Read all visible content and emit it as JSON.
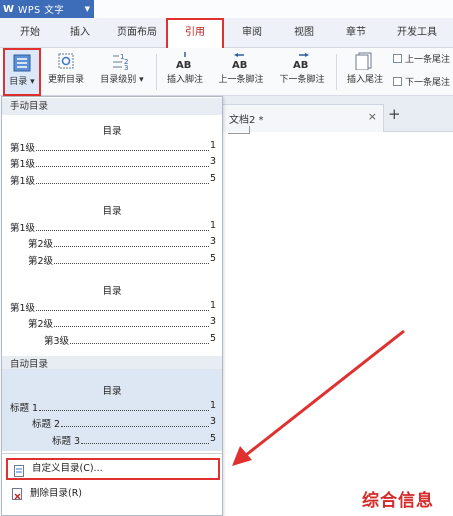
{
  "app": {
    "name": "WPS 文字"
  },
  "tabs": [
    {
      "label": "开始"
    },
    {
      "label": "插入"
    },
    {
      "label": "页面布局"
    },
    {
      "label": "引用"
    },
    {
      "label": "审阅"
    },
    {
      "label": "视图"
    },
    {
      "label": "章节"
    },
    {
      "label": "开发工具"
    }
  ],
  "active_tab": "引用",
  "ribbon": {
    "toc": "目录",
    "update_toc": "更新目录",
    "toc_level": "目录级别",
    "insert_footnote": "插入脚注",
    "prev_footnote": "上一条脚注",
    "next_footnote": "下一条脚注",
    "insert_endnote": "插入尾注",
    "prev_endnote": "上一条尾注",
    "next_endnote": "下一条尾注",
    "ab_glyph": "AB"
  },
  "document_tab": {
    "label": "文档2 *",
    "close": "×",
    "new": "+"
  },
  "dropdown": {
    "manual_header": "手动目录",
    "auto_header": "自动目录",
    "blocks": [
      {
        "title": "目录",
        "lines": [
          {
            "text": "第1级",
            "page": "1"
          },
          {
            "text": "第1级",
            "page": "3"
          },
          {
            "text": "第1级",
            "page": "5"
          }
        ]
      },
      {
        "title": "目录",
        "lines": [
          {
            "text": "第1级",
            "page": "1"
          },
          {
            "text": "第2级",
            "page": "3"
          },
          {
            "text": "第2级",
            "page": "5"
          }
        ]
      },
      {
        "title": "目录",
        "lines": [
          {
            "text": "第1级",
            "page": "1"
          },
          {
            "text": "第2级",
            "page": "3"
          },
          {
            "text": "第3级",
            "page": "5"
          }
        ]
      },
      {
        "title": "目录",
        "lines": [
          {
            "text": "标题 1",
            "page": "1"
          },
          {
            "text": "标题 2",
            "page": "3"
          },
          {
            "text": "标题 3",
            "page": "5"
          }
        ]
      }
    ],
    "custom_toc": "自定义目录(C)...",
    "delete_toc": "删除目录(R)"
  },
  "watermark": "综合信息",
  "colors": {
    "highlight_red": "#e03030",
    "app_blue": "#3d6cb8",
    "auto_bg": "#dde7f3"
  }
}
